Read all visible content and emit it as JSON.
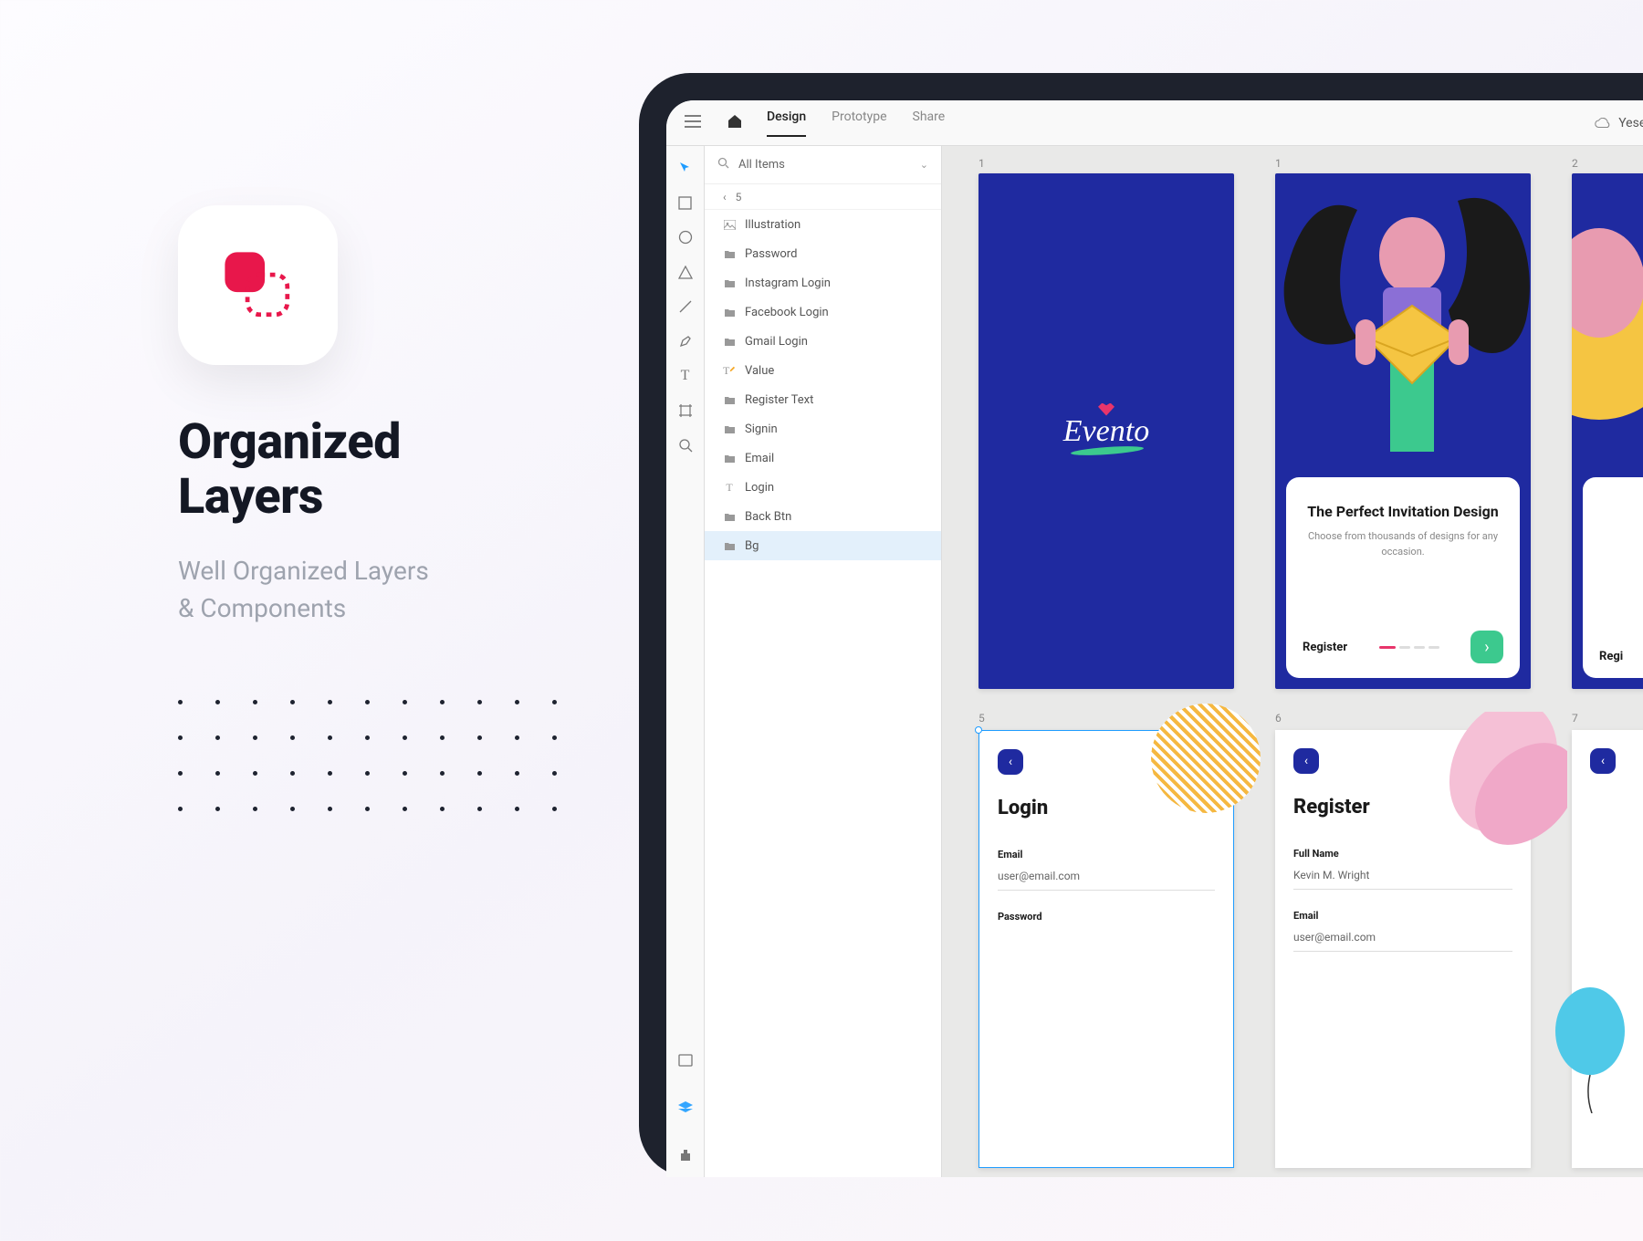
{
  "promo": {
    "title_l1": "Organized",
    "title_l2": "Layers",
    "sub_l1": "Well Organized Layers",
    "sub_l2": "& Components"
  },
  "app": {
    "tabs": {
      "design": "Design",
      "prototype": "Prototype",
      "share": "Share"
    },
    "document": "Yesevent"
  },
  "layers": {
    "search": "All Items",
    "crumb": "5",
    "items": [
      {
        "icon": "image",
        "label": "Illustration"
      },
      {
        "icon": "folder",
        "label": "Password"
      },
      {
        "icon": "folder",
        "label": "Instagram Login"
      },
      {
        "icon": "folder",
        "label": "Facebook Login"
      },
      {
        "icon": "folder",
        "label": "Gmail Login"
      },
      {
        "icon": "text-pencil",
        "label": "Value"
      },
      {
        "icon": "folder",
        "label": "Register Text"
      },
      {
        "icon": "folder",
        "label": "Signin"
      },
      {
        "icon": "folder",
        "label": "Email"
      },
      {
        "icon": "text",
        "label": "Login"
      },
      {
        "icon": "folder",
        "label": "Back Btn"
      },
      {
        "icon": "folder",
        "label": "Bg",
        "selected": true
      }
    ]
  },
  "artboards": {
    "n1": "1",
    "n2": "1",
    "n3": "2",
    "n5": "5",
    "n6": "6",
    "n7": "7",
    "a1_logo": "Evento",
    "a2_title": "The Perfect Invitation Design",
    "a2_desc": "Choose from thousands of designs for any occasion.",
    "a2_register": "Register",
    "a3_register": "Regi",
    "a5_title": "Login",
    "a5_email_label": "Email",
    "a5_email_val": "user@email.com",
    "a5_pw_label": "Password",
    "a6_title": "Register",
    "a6_name_label": "Full Name",
    "a6_name_val": "Kevin M. Wright",
    "a6_email_label": "Email",
    "a6_email_val": "user@email.com"
  }
}
